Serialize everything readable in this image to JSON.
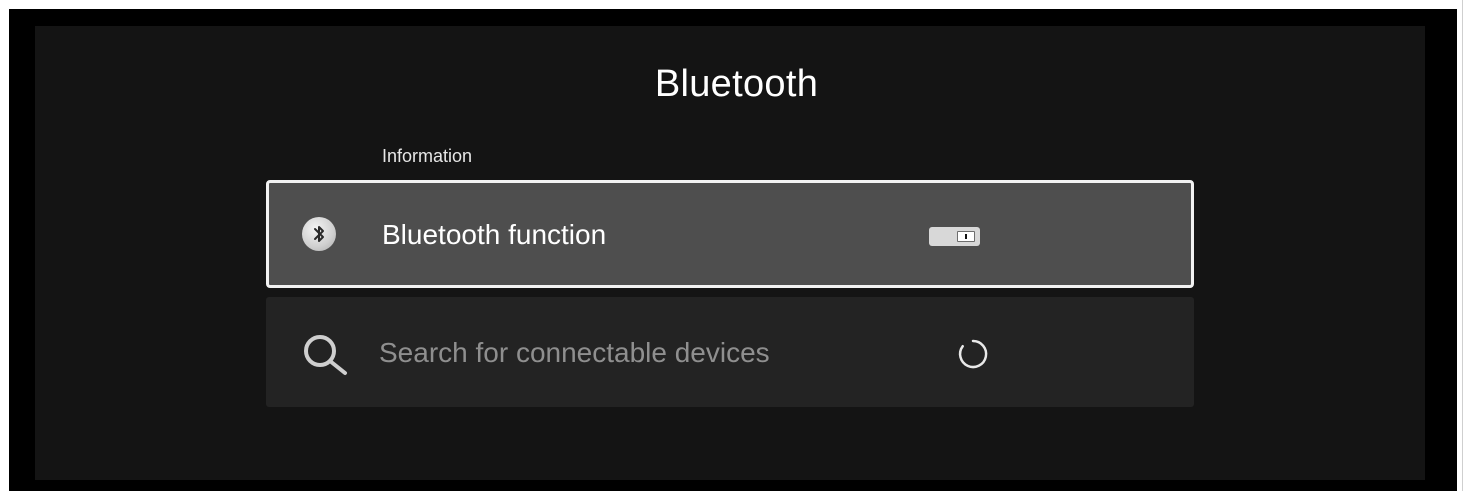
{
  "screen": {
    "title": "Bluetooth",
    "section_header": "Information"
  },
  "items": [
    {
      "label": "Bluetooth function",
      "icon": "bluetooth-icon",
      "control": "toggle",
      "toggle_on": true,
      "focused": true
    },
    {
      "label": "Search for connectable devices",
      "icon": "search-icon",
      "control": "spinner",
      "focused": false
    }
  ],
  "colors": {
    "background": "#141414",
    "focused_row": "#4e4e4e",
    "row": "#232323",
    "focus_border": "#f2f2f2",
    "text_primary": "#ffffff",
    "text_disabled": "#8f8f8f"
  }
}
